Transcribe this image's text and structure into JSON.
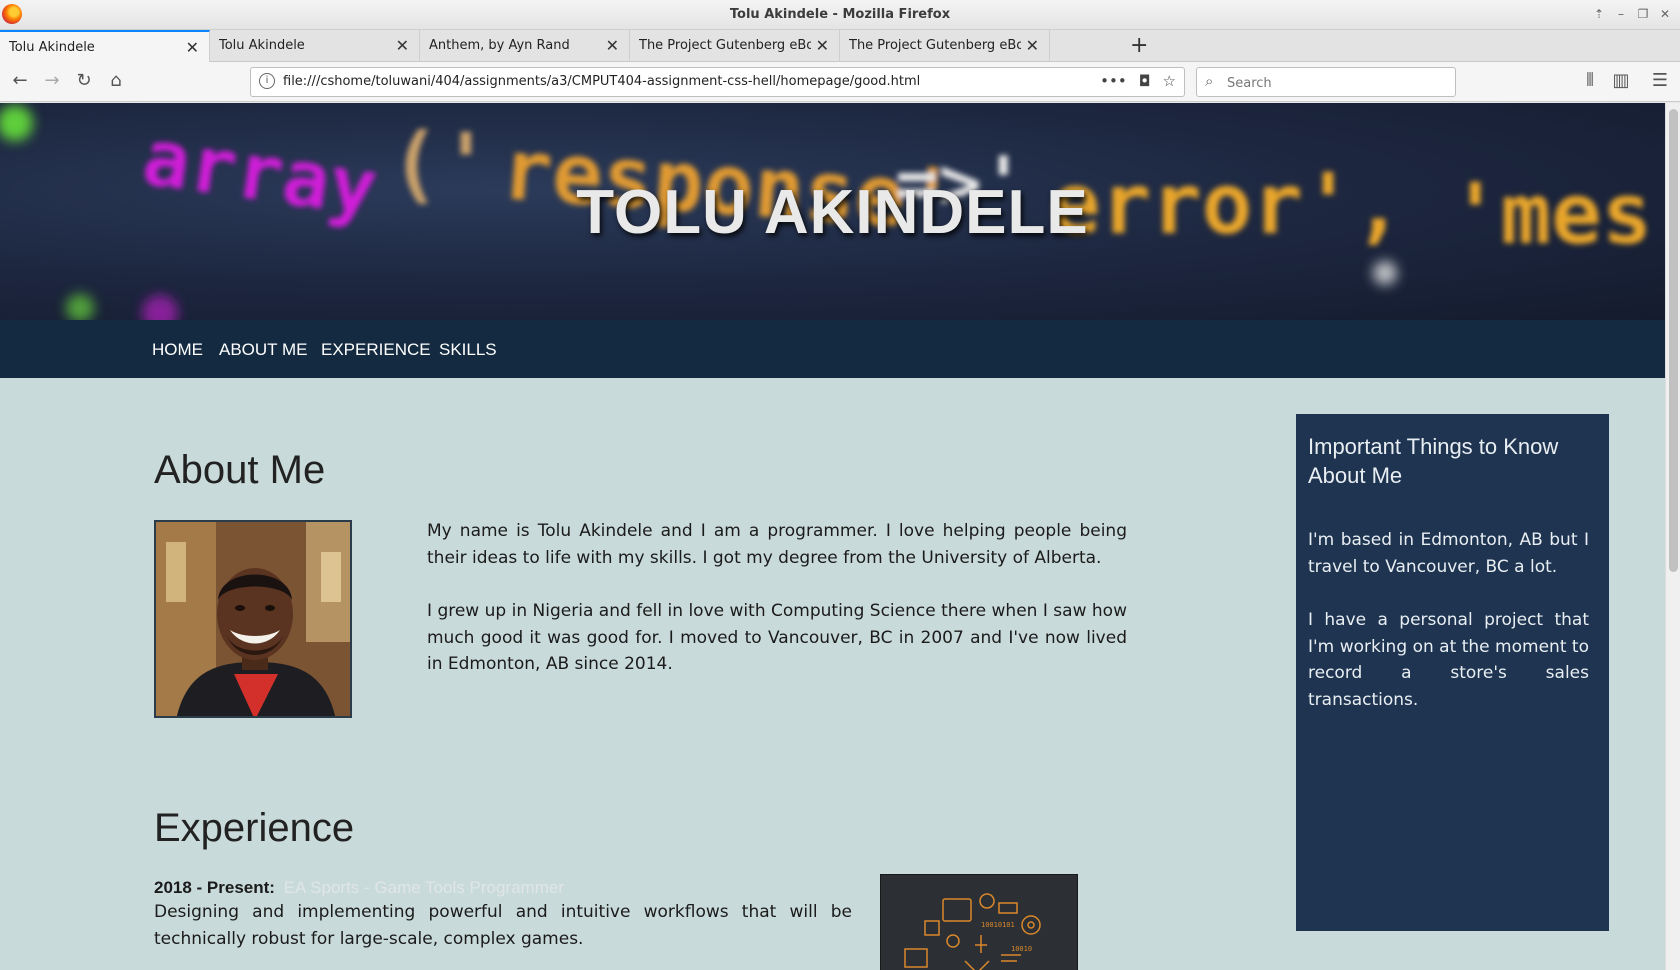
{
  "window": {
    "title": "Tolu Akindele - Mozilla Firefox"
  },
  "tabs": [
    {
      "label": "Tolu Akindele",
      "active": true
    },
    {
      "label": "Tolu Akindele",
      "active": false
    },
    {
      "label": "Anthem, by Ayn Rand",
      "active": false
    },
    {
      "label": "The Project Gutenberg eBook",
      "active": false
    },
    {
      "label": "The Project Gutenberg eBook",
      "active": false
    }
  ],
  "navbar": {
    "url": "file:///cshome/toluwani/404/assignments/a3/CMPUT404-assignment-css-hell/homepage/good.html",
    "search_placeholder": "Search"
  },
  "page": {
    "hero_title": "TOLU AKINDELE",
    "nav": [
      "HOME",
      "ABOUT ME",
      "EXPERIENCE",
      "SKILLS"
    ],
    "about": {
      "heading": "About Me",
      "paragraphs": [
        "My name is Tolu Akindele and I am a programmer. I love helping people being their ideas to life with my skills. I got my degree from the University of Alberta.",
        "I grew up in Nigeria and fell in love with Computing Science there when I saw how much good it was good for. I moved to Vancouver, BC in 2007 and I've now lived in Edmonton, AB since 2014."
      ]
    },
    "experience": {
      "heading": "Experience",
      "items": [
        {
          "period": "2018 - Present:",
          "role": "EA Sports - Game Tools Programmer",
          "description": "Designing and implementing powerful and intuitive workflows that will be technically robust for large-scale, complex games."
        }
      ]
    },
    "aside": {
      "heading": "Important Things to Know About Me",
      "paragraphs": [
        "I'm based in Edmonton, AB but I travel to Vancouver, BC a lot.",
        "I have a personal project that I'm working on at the moment to record a store's sales transactions."
      ]
    }
  },
  "colors": {
    "page_bg": "#c9dada",
    "nav_bg": "#142a40",
    "aside_bg": "#1e3450",
    "tab_accent": "#0a84ff"
  }
}
